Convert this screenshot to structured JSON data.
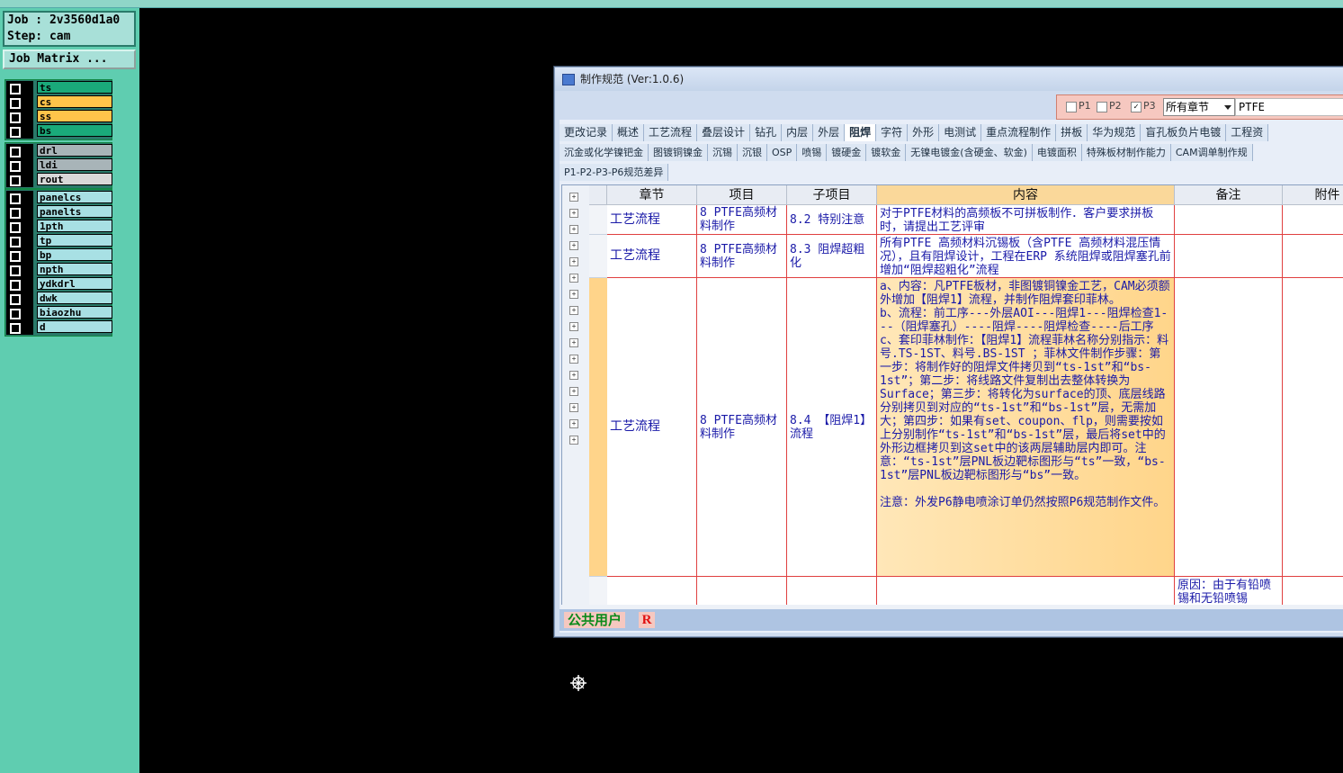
{
  "left": {
    "job_label": "Job : 2v3560d1a0",
    "step_label": "Step: cam",
    "job_matrix_button": "Job Matrix ...",
    "layer_groups": [
      [
        {
          "name": "ts",
          "color": "#1aaa7a"
        },
        {
          "name": "cs",
          "color": "#ffc44a"
        },
        {
          "name": "ss",
          "color": "#ffc44a"
        },
        {
          "name": "bs",
          "color": "#1aaa7a"
        }
      ],
      [
        {
          "name": "drl",
          "color": "#a8b4b8"
        },
        {
          "name": "ldi",
          "color": "#a8b4b8"
        },
        {
          "name": "rout",
          "color": "#d8d8d8"
        }
      ],
      [
        {
          "name": "panelcs",
          "color": "#a8e0e4"
        },
        {
          "name": "panelts",
          "color": "#a8e0e4"
        },
        {
          "name": "1pth",
          "color": "#a8e0e4"
        },
        {
          "name": "tp",
          "color": "#a8e0e4"
        },
        {
          "name": "bp",
          "color": "#a8e0e4"
        },
        {
          "name": "npth",
          "color": "#a8e0e4"
        },
        {
          "name": "ydkdrl",
          "color": "#a8e0e4"
        },
        {
          "name": "dwk",
          "color": "#a8e0e4"
        },
        {
          "name": "biaozhu",
          "color": "#a8e0e4"
        },
        {
          "name": "d",
          "color": "#a8e0e4"
        }
      ]
    ]
  },
  "window": {
    "title": "制作规范 (Ver:1.0.6)",
    "filter": {
      "p1": "P1",
      "p2": "P2",
      "p3": "P3",
      "p1_checked": false,
      "p2_checked": false,
      "p3_checked": true,
      "chapter_select": "所有章节",
      "search_value": "PTFE"
    },
    "tabs_row1": [
      "更改记录",
      "概述",
      "工艺流程",
      "叠层设计",
      "钻孔",
      "内层",
      "外层",
      "阻焊",
      "字符",
      "外形",
      "电测试",
      "重点流程制作",
      "拼板",
      "华为规范",
      "盲孔板负片电镀",
      "工程资"
    ],
    "active_tab": "阻焊",
    "tabs_row2": [
      "沉金或化学镍钯金",
      "图镀铜镍金",
      "沉锡",
      "沉银",
      "OSP",
      "喷锡",
      "镀硬金",
      "镀软金",
      "无镍电镀金(含硬金、软金)",
      "电镀面积",
      "特殊板材制作能力",
      "CAM调单制作规"
    ],
    "tabs_row3": [
      "P1-P2-P3-P6规范差异"
    ],
    "columns": [
      "章节",
      "项目",
      "子项目",
      "内容",
      "备注",
      "附件"
    ],
    "rows": [
      {
        "chapter": "工艺流程",
        "item": "8 PTFE高频材料制作",
        "sub": "8.2 特别注意",
        "content": [
          "对于PTFE材料的高频板不可拼板制作．客户要求拼板时，请提出工艺评审"
        ],
        "note": ""
      },
      {
        "chapter": "工艺流程",
        "item": "8 PTFE高频材料制作",
        "sub": "8.3 阻焊超粗化",
        "content": [
          "所有PTFE 高频材料沉锡板（含PTFE 高频材料混压情况），且有阻焊设计，工程在ERP 系统阻焊或阻焊塞孔前增加“阻焊超粗化”流程"
        ],
        "note": ""
      },
      {
        "chapter": "工艺流程",
        "item": "8 PTFE高频材料制作",
        "sub": "8.4 【阻焊1】流程",
        "content": [
          "a、内容：凡PTFE板材，非图镀铜镍金工艺，CAM必须额外增加【阻焊1】流程，并制作阻焊套印菲林。",
          "b、流程：前工序---外层AOI---阻焊1---阻焊检查1---（阻焊塞孔）----阻焊----阻焊检查----后工序",
          "c、套印菲林制作：【阻焊1】流程菲林名称分别指示：料号.TS-1ST、料号.BS-1ST ；菲林文件制作步骤：第一步：将制作好的阻焊文件拷贝到“ts-1st”和“bs-1st”；第二步：将线路文件复制出去整体转换为Surface；第三步：将转化为surface的顶、底层线路分别拷贝到对应的“ts-1st”和“bs-1st”层，无需加大；第四步：如果有set、coupon、flp，则需要按如上分别制作“ts-1st”和“bs-1st”层，最后将set中的外形边框拷贝到这set中的该两层辅助层内即可。注意：“ts-1st”层PNL板边靶标图形与“ts”一致，“bs-1st”层PNL板边靶标图形与“bs”一致。",
          "",
          "注意：外发P6静电喷涂订单仍然按照P6规范制作文件。"
        ],
        "note": ""
      },
      {
        "chapter": "",
        "item": "",
        "sub": "",
        "content": [
          ""
        ],
        "note": "原因：由于有铅喷锡和无铅喷锡"
      }
    ],
    "status_user": "公共用户",
    "status_r": "R"
  }
}
